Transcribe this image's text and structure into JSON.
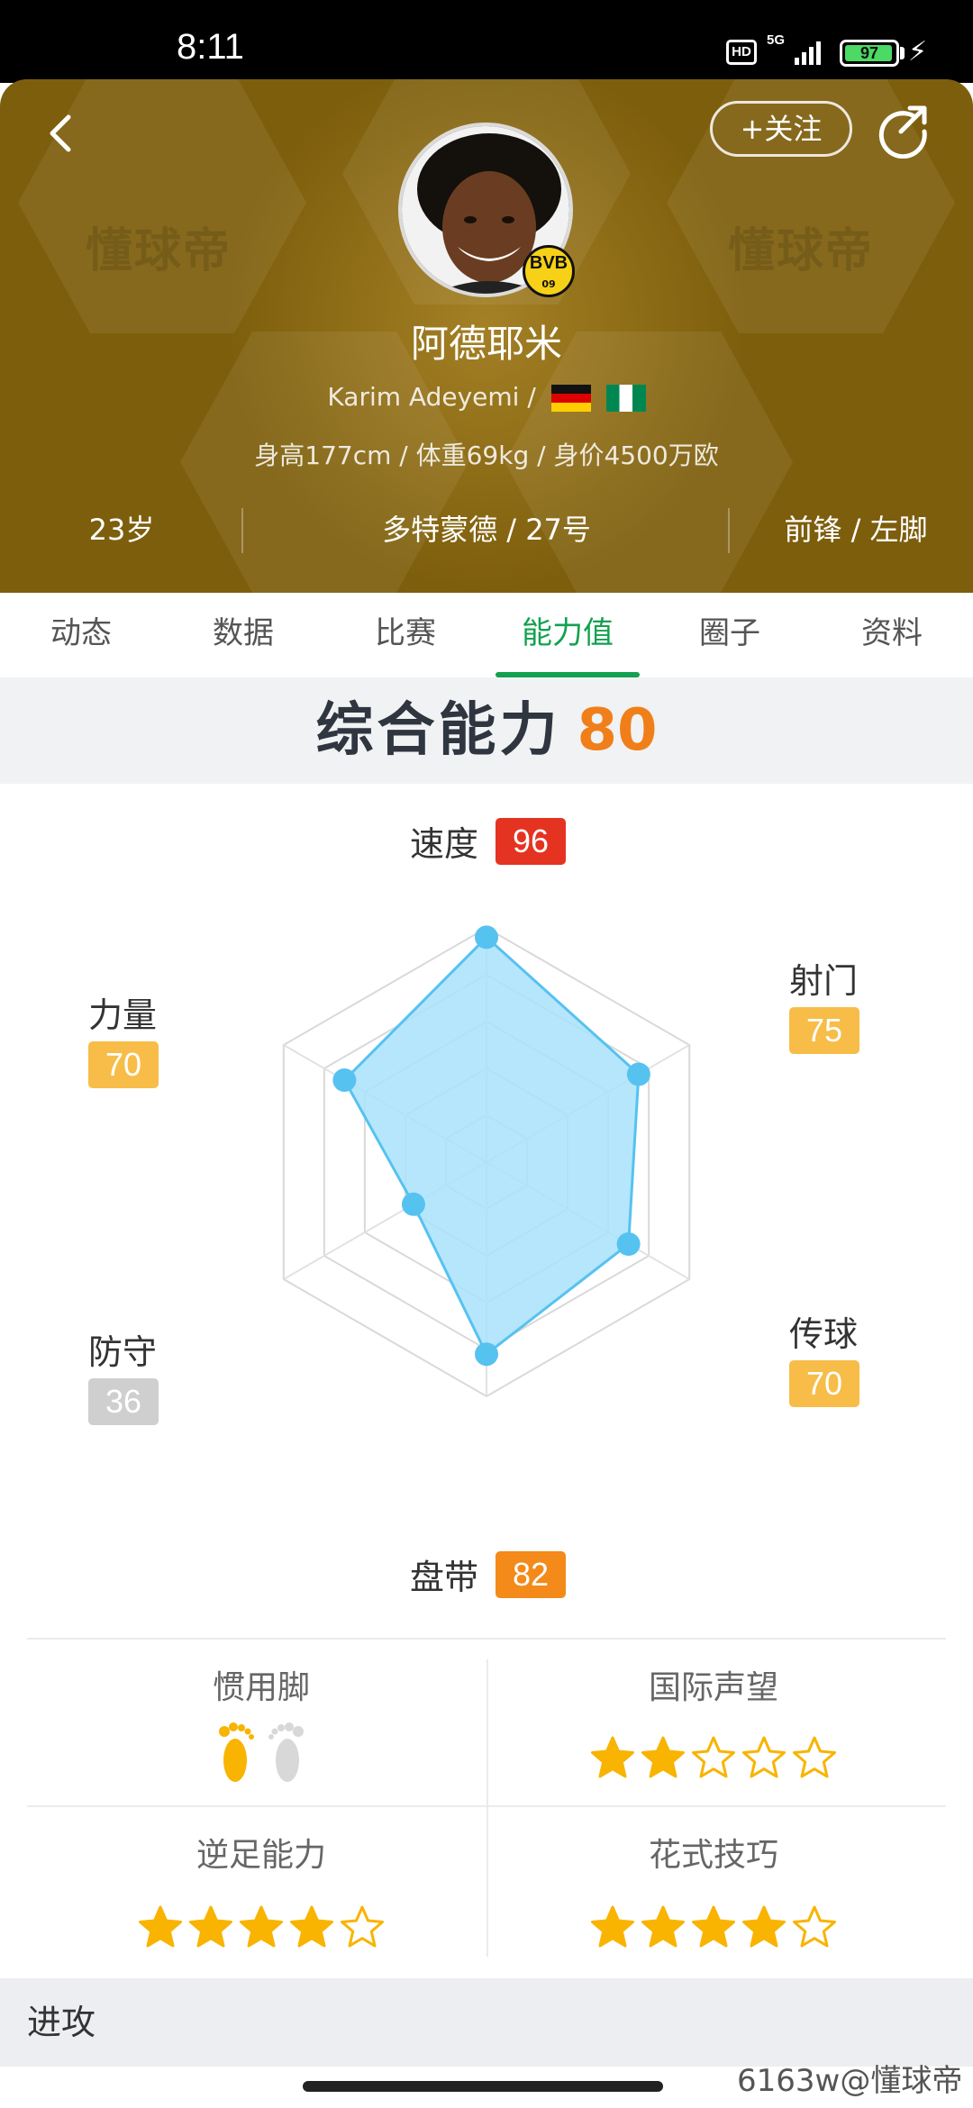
{
  "status_bar": {
    "time": "8:11",
    "hd": "HD",
    "network": "5G",
    "battery": "97",
    "battery_fraction": 0.97
  },
  "header": {
    "follow_label": "+关注",
    "watermark": "懂球帝",
    "name_cn": "阿德耶米",
    "name_en": "Karim Adeyemi /",
    "club_badge": "BVB",
    "club_badge_sub": "09",
    "bio": "身高177cm / 体重69kg / 身价4500万欧",
    "age": "23岁",
    "club_number": "多特蒙德 / 27号",
    "position_foot": "前锋 / 左脚"
  },
  "tabs": [
    {
      "label": "动态"
    },
    {
      "label": "数据"
    },
    {
      "label": "比赛"
    },
    {
      "label": "能力值",
      "active": true
    },
    {
      "label": "圈子"
    },
    {
      "label": "资料"
    }
  ],
  "ability": {
    "title": "综合能力",
    "score": "80"
  },
  "chart_data": {
    "type": "radar",
    "max": 100,
    "axes": [
      {
        "label": "速度",
        "value": 96,
        "badge_color": "#e53322"
      },
      {
        "label": "射门",
        "value": 75,
        "badge_color": "#f7bd48"
      },
      {
        "label": "传球",
        "value": 70,
        "badge_color": "#f7bd48"
      },
      {
        "label": "盘带",
        "value": 82,
        "badge_color": "#f38a19"
      },
      {
        "label": "防守",
        "value": 36,
        "badge_color": "#cfcfcf"
      },
      {
        "label": "力量",
        "value": 70,
        "badge_color": "#f7bd48"
      }
    ],
    "fill_color": "#a9e2fb",
    "stroke_color": "#56c2f0",
    "point_color": "#56c2f0",
    "grid_levels": 5
  },
  "traits": {
    "preferred_foot": {
      "title": "惯用脚",
      "left_active": true,
      "right_active": false
    },
    "reputation": {
      "title": "国际声望",
      "stars": 2,
      "max": 5
    },
    "weak_foot": {
      "title": "逆足能力",
      "stars": 4,
      "max": 5
    },
    "skill_moves": {
      "title": "花式技巧",
      "stars": 4,
      "max": 5
    }
  },
  "attack": {
    "label": "进攻"
  },
  "credit": "6163w@懂球帝",
  "colors": {
    "accent": "#12a150",
    "header_bg": "#7d5e0c",
    "score": "#f07f1a",
    "star": "#f8b400"
  }
}
